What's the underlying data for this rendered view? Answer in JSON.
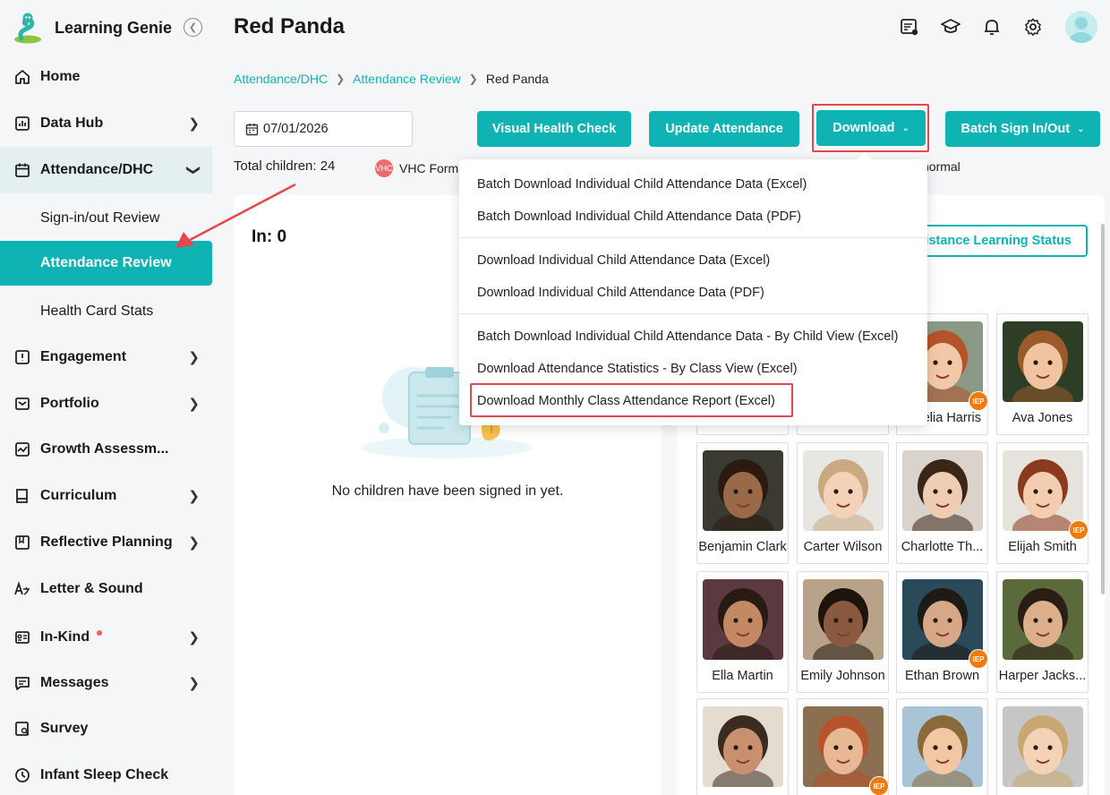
{
  "app": {
    "name": "Learning Genie"
  },
  "sidebar": {
    "items": [
      {
        "label": "Home",
        "icon": "home-icon"
      },
      {
        "label": "Data Hub",
        "icon": "data-hub-icon"
      },
      {
        "label": "Attendance/DHC",
        "icon": "calendar-icon"
      },
      {
        "label": "Engagement",
        "icon": "engagement-icon"
      },
      {
        "label": "Portfolio",
        "icon": "portfolio-icon"
      },
      {
        "label": "Growth Assessm...",
        "icon": "growth-icon"
      },
      {
        "label": "Curriculum",
        "icon": "curriculum-icon"
      },
      {
        "label": "Reflective Planning",
        "icon": "planning-icon"
      },
      {
        "label": "Letter & Sound",
        "icon": "letter-sound-icon"
      },
      {
        "label": "In-Kind",
        "icon": "in-kind-icon"
      },
      {
        "label": "Messages",
        "icon": "messages-icon"
      },
      {
        "label": "Survey",
        "icon": "survey-icon"
      },
      {
        "label": "Infant Sleep Check",
        "icon": "sleep-check-icon"
      }
    ],
    "sub_items": [
      {
        "label": "Sign-in/out Review"
      },
      {
        "label": "Attendance Review"
      },
      {
        "label": "Health Card Stats"
      }
    ]
  },
  "header": {
    "title": "Red Panda"
  },
  "breadcrumb": [
    "Attendance/DHC",
    "Attendance Review",
    "Red Panda"
  ],
  "controls": {
    "date": "07/01/2026",
    "visual_health_check": "Visual Health Check",
    "update_attendance": "Update Attendance",
    "download": "Download",
    "batch_sign": "Batch Sign In/Out"
  },
  "summary": {
    "total_children": "Total children: 24",
    "vhc_legend": "VHC Form",
    "vhc_badge": "VHC",
    "normal_legend": "normal"
  },
  "left_panel": {
    "in_count": "In: 0",
    "empty_message": "No children have been signed in yet."
  },
  "right_panel": {
    "distance_button": "Distance Learning Status"
  },
  "dropdown": {
    "items": [
      "Batch Download Individual Child Attendance Data (Excel)",
      "Batch Download Individual Child Attendance Data (PDF)",
      "Download Individual Child Attendance Data (Excel)",
      "Download Individual Child Attendance Data (PDF)",
      "Batch Download Individual Child Attendance Data - By Child View (Excel)",
      "Download Attendance Statistics - By Class View (Excel)",
      "Download Monthly Class Attendance Report (Excel)"
    ]
  },
  "children": [
    {
      "name": "Amelia Harris",
      "iep": true,
      "skin": "#f1c9a8",
      "hair": "#b5532a",
      "bg": "#8a9a86"
    },
    {
      "name": "Ava Jones",
      "iep": false,
      "skin": "#f0c4a0",
      "hair": "#9a5a2c",
      "bg": "#2e3e26"
    },
    {
      "name": "Benjamin Clark",
      "iep": false,
      "skin": "#9a6a48",
      "hair": "#2a1a12",
      "bg": "#3a3a30"
    },
    {
      "name": "Carter Wilson",
      "iep": false,
      "skin": "#f3d2b8",
      "hair": "#c9a882",
      "bg": "#e8e6e2"
    },
    {
      "name": "Charlotte Th...",
      "iep": false,
      "skin": "#eecdb2",
      "hair": "#3a2618",
      "bg": "#d9d3cc"
    },
    {
      "name": "Elijah Smith",
      "iep": true,
      "skin": "#f2cdb0",
      "hair": "#8a3a1e",
      "bg": "#e6e2dc"
    },
    {
      "name": "Ella Martin",
      "iep": false,
      "skin": "#c38864",
      "hair": "#2a1a14",
      "bg": "#5a3a40"
    },
    {
      "name": "Emily Johnson",
      "iep": false,
      "skin": "#8a5a40",
      "hair": "#1e140e",
      "bg": "#b8a28a"
    },
    {
      "name": "Ethan Brown",
      "iep": true,
      "skin": "#d7a888",
      "hair": "#1e1a16",
      "bg": "#2a4a5a"
    },
    {
      "name": "Harper Jacks...",
      "iep": false,
      "skin": "#dcb08c",
      "hair": "#2a1e16",
      "bg": "#5a6a3a"
    },
    {
      "name": "",
      "iep": false,
      "skin": "#c99070",
      "hair": "#3a2a20",
      "bg": "#e4dcd0"
    },
    {
      "name": "",
      "iep": true,
      "skin": "#e8b894",
      "hair": "#b5532a",
      "bg": "#8a7050"
    },
    {
      "name": "",
      "iep": false,
      "skin": "#f2c8a4",
      "hair": "#8a6a3a",
      "bg": "#a8c4d6"
    },
    {
      "name": "",
      "iep": false,
      "skin": "#f4d2b8",
      "hair": "#c8a870",
      "bg": "#c6c6c6"
    }
  ],
  "colors": {
    "accent": "#10b3b3",
    "highlight": "#e2484c",
    "iep": "#ef7b0c"
  }
}
